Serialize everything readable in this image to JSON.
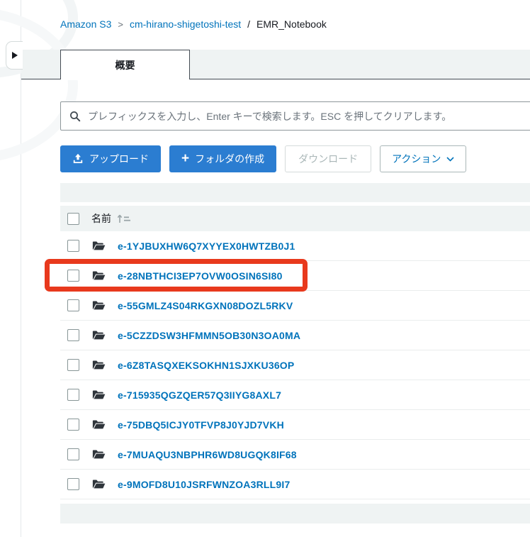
{
  "breadcrumb": {
    "root": "Amazon S3",
    "chevron": ">",
    "bucket": "cm-hirano-shigetoshi-test",
    "slash": "/",
    "folder": "EMR_Notebook"
  },
  "tab": {
    "label": "概要"
  },
  "search": {
    "placeholder": "プレフィックスを入力し、Enter キーで検索します。ESC を押してクリアします。",
    "value": ""
  },
  "toolbar": {
    "upload_label": "アップロード",
    "create_folder_label": "フォルダの作成",
    "download_label": "ダウンロード",
    "actions_label": "アクション"
  },
  "table": {
    "name_header": "名前",
    "select_all_checked": false,
    "rows": [
      {
        "name": "e-1YJBUXHW6Q7XYYEX0HWTZB0J1",
        "checked": false
      },
      {
        "name": "e-28NBTHCI3EP7OVW0OSIN6SI80",
        "checked": false
      },
      {
        "name": "e-55GMLZ4S04RKGXN08DOZL5RKV",
        "checked": false
      },
      {
        "name": "e-5CZZDSW3HFMMN5OB30N3OA0MA",
        "checked": false
      },
      {
        "name": "e-6Z8TASQXEKSOKHN1SJXKU36OP",
        "checked": false
      },
      {
        "name": "e-715935QGZQER57Q3IIYG8AXL7",
        "checked": false
      },
      {
        "name": "e-75DBQ5ICJY0TFVP8J0YJD7VKH",
        "checked": false
      },
      {
        "name": "e-7MUAQU3NBPHR6WD8UGQK8IF68",
        "checked": false
      },
      {
        "name": "e-9MOFD8U10JSRFWNZOA3RLL9I7",
        "checked": false
      }
    ]
  },
  "annotation": {
    "highlighted_row": "e-28NBTHCI3EP7OVW0OSIN6SI80",
    "highlight_color": "#e8391d"
  },
  "icons": {
    "expand_arrow": "right-pointing-triangle",
    "search": "magnifier",
    "upload": "tray-with-up-arrow",
    "plus": "+",
    "chevron_down": "v",
    "sort": "arrow-up-with-lines",
    "folder": "open-folder"
  },
  "colors": {
    "link_blue": "#0073bb",
    "primary_button_blue": "#2b7dd1",
    "tab_border_dark": "#434b53",
    "panel_gray": "#eff3f3",
    "row_divider": "#eaeded",
    "disabled_text": "#aab7b8",
    "annotation_red": "#e8391d"
  }
}
